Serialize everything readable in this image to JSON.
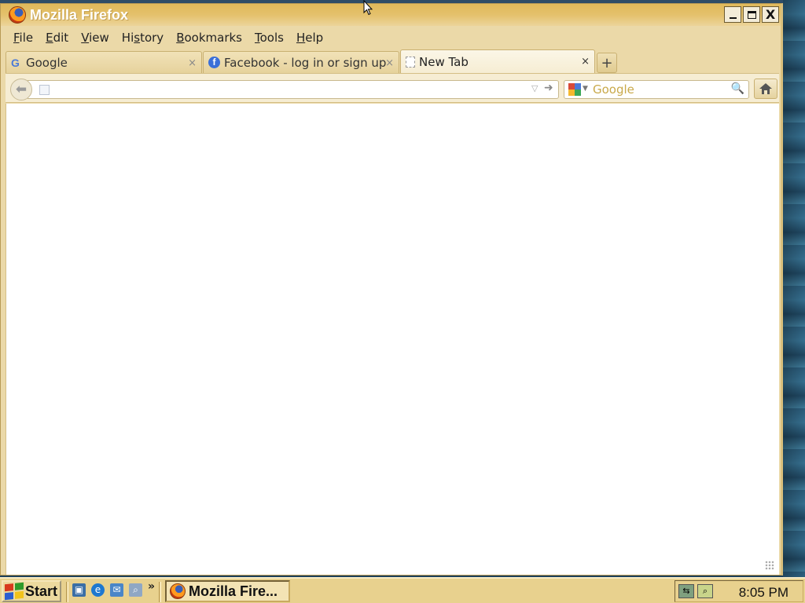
{
  "window": {
    "title": "Mozilla Firefox",
    "controls": {
      "minimize": "_",
      "maximize": "□",
      "close": "X"
    }
  },
  "menubar": {
    "items": [
      {
        "label": "File",
        "accel": "F",
        "rest": "ile"
      },
      {
        "label": "Edit",
        "accel": "E",
        "rest": "dit"
      },
      {
        "label": "View",
        "accel": "V",
        "rest": "iew"
      },
      {
        "label": "History",
        "pre": "Hi",
        "accel": "s",
        "rest": "tory"
      },
      {
        "label": "Bookmarks",
        "accel": "B",
        "rest": "ookmarks"
      },
      {
        "label": "Tools",
        "accel": "T",
        "rest": "ools"
      },
      {
        "label": "Help",
        "accel": "H",
        "rest": "elp"
      }
    ]
  },
  "tabs": [
    {
      "label": "Google",
      "favicon": "google-favicon",
      "active": false,
      "close": "×"
    },
    {
      "label": "Facebook - log in or sign up",
      "favicon": "facebook-favicon",
      "active": false,
      "close": "×"
    },
    {
      "label": "New Tab",
      "favicon": "blank-page-icon",
      "active": true,
      "close": "×"
    }
  ],
  "new_tab_button": "+",
  "navbar": {
    "url_value": "",
    "search_placeholder": "Google",
    "search_engine": "google-icon"
  },
  "taskbar": {
    "start_label": "Start",
    "task_button_label": "Mozilla Fire...",
    "clock": "8:05 PM",
    "quicklaunch_more": "»"
  },
  "colors": {
    "titlebar": "#e0b95a",
    "chrome": "#ebd9a8",
    "taskbar": "#e8d18e",
    "content_bg": "#ffffff"
  }
}
